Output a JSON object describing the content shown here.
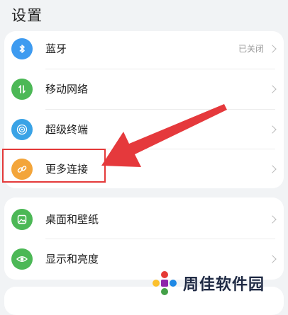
{
  "header": {
    "title": "设置"
  },
  "group1": {
    "items": [
      {
        "label": "蓝牙",
        "value": "已关闭",
        "icon": "bluetooth-icon",
        "color": "#3e9bf0"
      },
      {
        "label": "移动网络",
        "icon": "mobile-network-icon",
        "color": "#4cb856"
      },
      {
        "label": "超级终端",
        "icon": "super-device-icon",
        "color": "#3aa3e6"
      },
      {
        "label": "更多连接",
        "icon": "link-icon",
        "color": "#f3a53a"
      }
    ]
  },
  "group2": {
    "items": [
      {
        "label": "桌面和壁纸",
        "icon": "wallpaper-icon",
        "color": "#4cb856"
      },
      {
        "label": "显示和亮度",
        "icon": "eye-icon",
        "color": "#4cb856"
      }
    ]
  },
  "annotation": {
    "highlight_color": "#e43a3a"
  },
  "watermark": {
    "text": "周佳软件园"
  }
}
